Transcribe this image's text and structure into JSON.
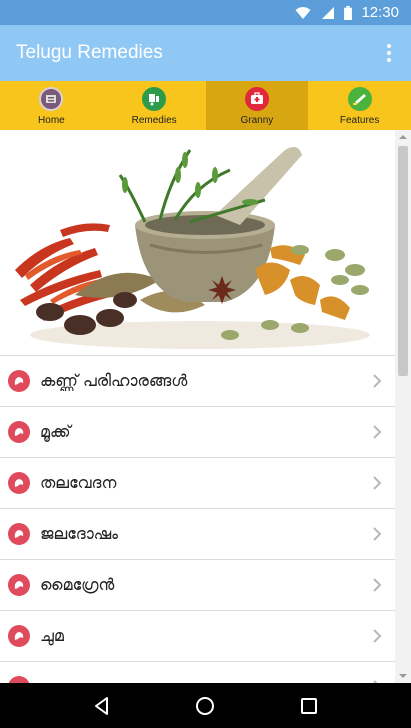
{
  "status_bar": {
    "time": "12:30",
    "icons": [
      "wifi-icon",
      "signal-icon",
      "battery-icon"
    ]
  },
  "app_bar": {
    "title": "Telugu Remedies",
    "menu_icon": "overflow-menu-icon"
  },
  "tabs": [
    {
      "label": "Home",
      "icon": "home-icon",
      "active": false
    },
    {
      "label": "Remedies",
      "icon": "remedies-icon",
      "active": false
    },
    {
      "label": "Granny",
      "icon": "first-aid-kit-icon",
      "active": true
    },
    {
      "label": "Features",
      "icon": "features-icon",
      "active": false
    }
  ],
  "hero": {
    "icon": "herbs-mortar-pestle-image"
  },
  "list": {
    "items": [
      {
        "label": "കണ്ണ് പരിഹാരങ്ങൾ"
      },
      {
        "label": "മൂക്ക്"
      },
      {
        "label": "തലവേദന"
      },
      {
        "label": "ജലദോഷം"
      },
      {
        "label": "മൈഗ്രേൻ"
      },
      {
        "label": "ചുമ"
      },
      {
        "label": ""
      }
    ]
  },
  "colors": {
    "status_bar": "#5b9ed9",
    "app_bar": "#90c8f5",
    "tab_bar": "#f7c51b",
    "tab_active": "#d8a611",
    "list_icon": "#e04a5d"
  },
  "nav_bar": {
    "icons": [
      "back-icon",
      "home-circle-icon",
      "recents-icon"
    ]
  }
}
